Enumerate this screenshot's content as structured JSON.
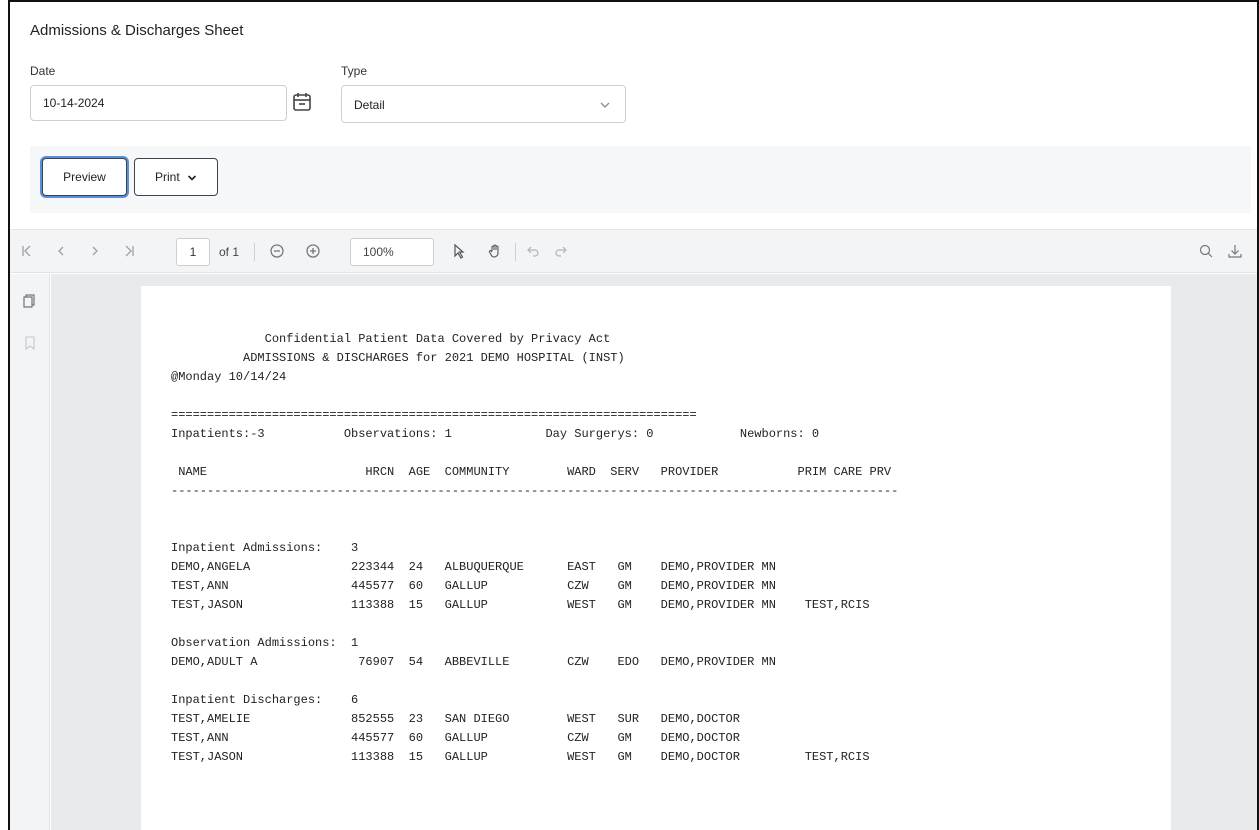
{
  "app": {
    "title": "Admissions & Discharges Sheet"
  },
  "form": {
    "date_label": "Date",
    "date_value": "10-14-2024",
    "type_label": "Type",
    "type_value": "Detail"
  },
  "actions": {
    "preview_label": "Preview",
    "print_label": "Print"
  },
  "viewer_toolbar": {
    "page_value": "1",
    "page_of": "of 1",
    "zoom_value": "100%"
  },
  "report": {
    "lines": [
      "             Confidential Patient Data Covered by Privacy Act",
      "          ADMISSIONS & DISCHARGES for 2021 DEMO HOSPITAL (INST)",
      "@Monday 10/14/24",
      "",
      "=========================================================================",
      "Inpatients:-3           Observations: 1             Day Surgerys: 0            Newborns: 0",
      "",
      " NAME                      HRCN  AGE  COMMUNITY        WARD  SERV   PROVIDER           PRIM CARE PRV",
      "-----------------------------------------------------------------------------------------------------",
      "",
      "",
      "Inpatient Admissions:    3",
      "DEMO,ANGELA              223344  24   ALBUQUERQUE      EAST   GM    DEMO,PROVIDER MN",
      "TEST,ANN                 445577  60   GALLUP           CZW    GM    DEMO,PROVIDER MN",
      "TEST,JASON               113388  15   GALLUP           WEST   GM    DEMO,PROVIDER MN    TEST,RCIS",
      "",
      "Observation Admissions:  1",
      "DEMO,ADULT A              76907  54   ABBEVILLE        CZW    EDO   DEMO,PROVIDER MN",
      "",
      "Inpatient Discharges:    6",
      "TEST,AMELIE              852555  23   SAN DIEGO        WEST   SUR   DEMO,DOCTOR",
      "TEST,ANN                 445577  60   GALLUP           CZW    GM    DEMO,DOCTOR",
      "TEST,JASON               113388  15   GALLUP           WEST   GM    DEMO,DOCTOR         TEST,RCIS"
    ]
  },
  "icons": {
    "calendar": "calendar-icon",
    "chevron": "chevron-down-icon",
    "first": "first-page-icon",
    "prev": "prev-page-icon",
    "next": "next-page-icon",
    "last": "last-page-icon",
    "zoom_out": "zoom-out-icon",
    "zoom_in": "zoom-in-icon",
    "select": "pointer-icon",
    "pan": "hand-icon",
    "undo": "undo-icon",
    "redo": "redo-icon",
    "search": "search-icon",
    "download": "download-icon",
    "thumbnails": "thumbnails-icon",
    "bookmarks": "bookmark-icon"
  }
}
